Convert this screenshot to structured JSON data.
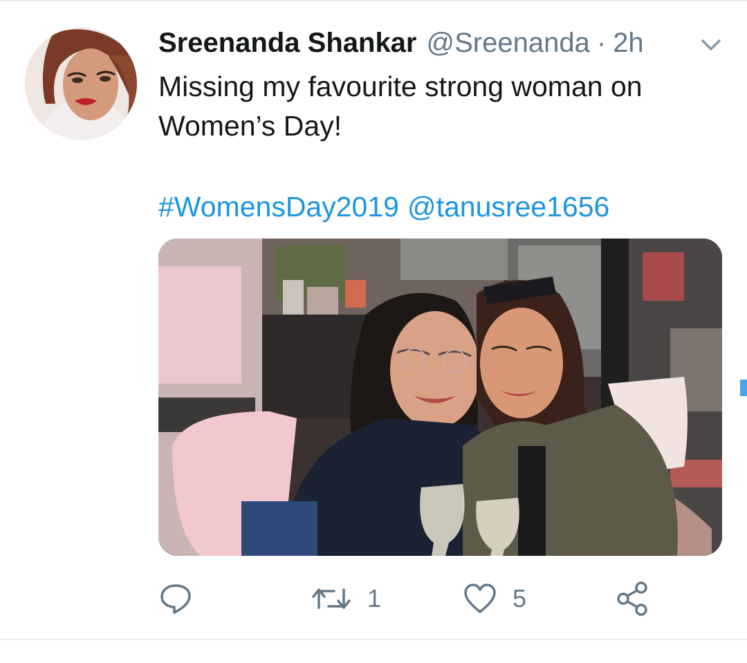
{
  "tweet": {
    "author": {
      "name": "Sreenanda Shankar",
      "handle": "@Sreenanda",
      "separator": "·",
      "time": "2h"
    },
    "text_lines": [
      "Missing my favourite strong woman on",
      "Women’s Day!"
    ],
    "hashtag": "#WomensDay2019",
    "mention": "@tanusree1656",
    "actions": {
      "reply_icon": "speech-bubble-icon",
      "retweet_icon": "retweet-arrows-icon",
      "retweet_count": "1",
      "like_icon": "heart-icon",
      "like_count": "5",
      "share_icon": "share-nodes-icon"
    },
    "menu_icon": "chevron-down-icon"
  },
  "colors": {
    "text": "#14171a",
    "secondary": "#657786",
    "link": "#1b95e0",
    "divider": "#e6ecf0"
  }
}
